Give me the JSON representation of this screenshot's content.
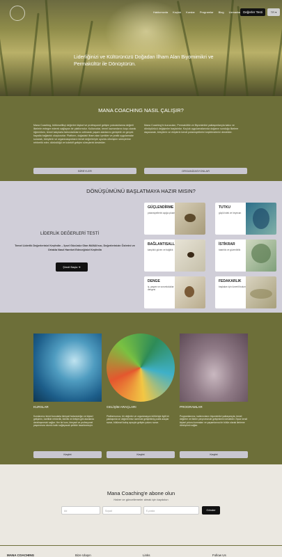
{
  "hero": {
    "nav": [
      "Hakkımızda",
      "Koçluk",
      "Kurslar",
      "Programlar",
      "Blog",
      "Uzmanlar"
    ],
    "test_button": "Değerler Testi",
    "lang": "TR ▾",
    "title": "Liderliğinizi ve Kültürünüzü Doğadan İlham Alan Biyomimikri ve Permakültür ile Dönüştürün."
  },
  "how": {
    "title": "MANA COACHING NASIL ÇALIŞIR?",
    "p1": "Mana Coaching, bütünsellikçi değerleri kişisel ve profesyonel gelişim yolculuklarına değerli ilkelerle entegre ederek sağlayan bir platformdur. Kullanıcılar, temel kavramlarını koçu olarak öğrenirken, temel kalıplarla farkındalıklarını arttırarak yaşam alanlarını genişletir ve gerçek hayatla bağlantılı oluştururlar. Platform, doğadaki ilham alan içerikler ve pratik uygulamalar sunarak, bireylerin ve organizasyonların temel değerleriyle uyumlu dönüşüm süreçlerine rehberlik eder; dürüstlüğü ve kolektif gelişim süreçlerini destekler.",
    "p2": "Mana Coaching'in kurucuları, Permakültür ve Biyomimikri yaklaşımlarıyla kalıcı ve dönüştürücü değişimler başlatırlar. Koçluk uygulamalarında doğanın sunduğu ilkelere dayanarak, bireylerin ve ekiplerin kendi potansiyellerini keşfetmelerini destekler.",
    "btn_individuals": "BİREYLER",
    "btn_orgs": "ORGANİZASYONLAR"
  },
  "transform": {
    "title": "DÖNÜŞÜMÜNÜ BAŞLATMAYA HAZIR MISIN?",
    "test_title": "LİDERLİK DEĞERLERİ TESTİ",
    "test_desc": "Temel Liderlik Değerlerinizi Keşfedin – İçsel Gücünüz Olan MANA'nızı, Değerlerinizin Özlerini ve Ortakla Nasıl Hareket Edeceğinizi Keşfedin",
    "start": "Şimdi Başla ➜",
    "cards": [
      {
        "title": "GÜÇLENDİRME",
        "desc": "potansiyellerini açığa çıkarmak"
      },
      {
        "title": "TUTKU",
        "desc": "güçlü istek ve heyecan"
      },
      {
        "title": "BAĞLANTISALLIK",
        "desc": "karşılıklı güven ve bağlılık"
      },
      {
        "title": "İSTİKRAR",
        "desc": "tutarlılık ve güvenilirlik"
      },
      {
        "title": "DENGE",
        "desc": "iş, yaşam ve sorumluluklar dengesi"
      },
      {
        "title": "FEDAKARLIK",
        "desc": "başkaları için özverili bulunmak"
      }
    ]
  },
  "programs": {
    "items": [
      {
        "title": "KURSLAR",
        "desc": "Kurslarımız temel konularla bireysel farkındalığın ve kişisel gelişimin, özellikle rehberlik, liderlik ve iletişim gibi alanlarda derinleşmesini sağlar. Her bir kurs, bireysel ve profesyonel yaşamınıza olumlu katkı sağlayacak şekilde tasarlanmıştır.",
        "button": "Keşfet"
      },
      {
        "title": "GELİŞİM ARAÇLARI",
        "desc": "Platformumuz, bir değerler ve organizasyon kültürüyle ilgili bir yaklaşımla ve değerlerimiz üzerinde geliştirilmiş pratik araçlar sunar, bütünsel bakış açısıyla gelişim yolunu sunar.",
        "button": "Keşfet"
      },
      {
        "title": "PROGRAMLAR",
        "desc": "Programlarımız, katılımcıların biyomimikri yaklaşımıyla, temel değerler ve ilkeler çerçevesinde gelişimlerini destekler. Eşsiz kendi kişisel yolunu kurmaları ve yaşamlarına bir bütün olarak ilerleme dönüşümü sağlar.",
        "button": "Keşfet"
      }
    ]
  },
  "subscribe": {
    "title": "Mana Coaching'e abone olun",
    "desc": "Haber ve güncellemeler almak için kaydolun",
    "first_name": "Ad",
    "last_name": "Soyad",
    "email": "E-posta",
    "send": "Gönder"
  },
  "footer": {
    "brand": "MANA COACHING",
    "col1": "Bize Ulaşın",
    "col2": "Links",
    "col3": "Follow Us"
  }
}
